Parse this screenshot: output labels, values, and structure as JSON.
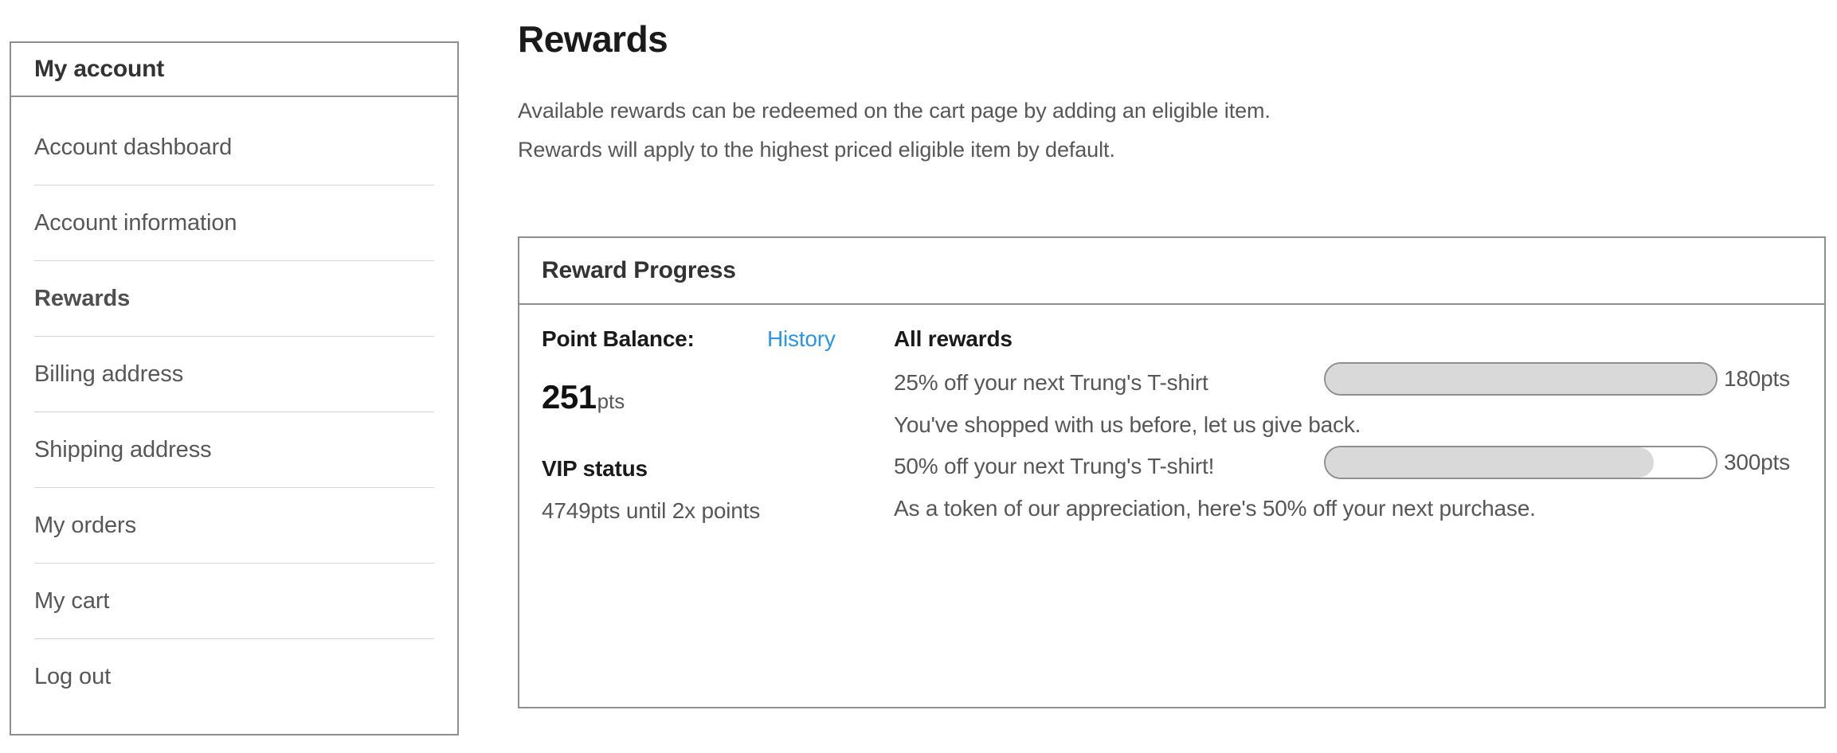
{
  "sidebar": {
    "title": "My account",
    "items": [
      {
        "label": "Account dashboard",
        "active": false
      },
      {
        "label": "Account information",
        "active": false
      },
      {
        "label": "Rewards",
        "active": true
      },
      {
        "label": "Billing address",
        "active": false
      },
      {
        "label": "Shipping address",
        "active": false
      },
      {
        "label": "My orders",
        "active": false
      },
      {
        "label": "My cart",
        "active": false
      },
      {
        "label": "Log out",
        "active": false
      }
    ]
  },
  "main": {
    "page_title": "Rewards",
    "intro_line_1": "Available rewards can be redeemed on the cart page by adding an eligible item.",
    "intro_line_2": "Rewards will apply to the highest priced eligible item by default."
  },
  "panel": {
    "header_title": "Reward Progress",
    "point_balance_label": "Point Balance:",
    "history_link": "History",
    "all_rewards_label": "All rewards",
    "balance_number": "251",
    "balance_unit": "pts",
    "vip_title": "VIP status",
    "vip_subtitle": "4749pts until 2x points",
    "rewards": [
      {
        "name": "25% off your next Trung's T-shirt",
        "description": "You've shopped with us before, let us give back.",
        "threshold_label": "180pts",
        "threshold_points": 180,
        "progress_percent": 100
      },
      {
        "name": "50% off your next Trung's T-shirt!",
        "description": "As a token of our appreciation, here's 50% off your next purchase.",
        "threshold_label": "300pts",
        "threshold_points": 300,
        "progress_percent": 84
      }
    ]
  },
  "colors": {
    "link_blue": "#2a96e8",
    "border_gray": "#8f8f8f",
    "bar_fill": "#d9d9d9",
    "text_gray": "#575757"
  }
}
